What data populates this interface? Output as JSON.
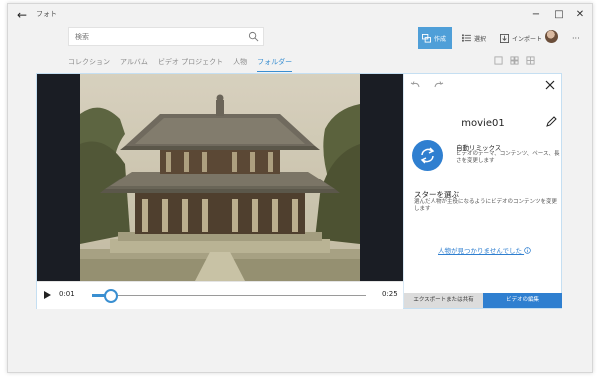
{
  "titlebar": {
    "back": "←",
    "app_title": "フォト",
    "minimize": "−",
    "maximize": "□",
    "close": "✕"
  },
  "toolbar": {
    "search_placeholder": "検索",
    "create_label": "作成",
    "select_label": "選択",
    "import_label": "インポート",
    "more": "···"
  },
  "nav": {
    "items": [
      {
        "label": "コレクション"
      },
      {
        "label": "アルバム"
      },
      {
        "label": "ビデオ プロジェクト"
      },
      {
        "label": "人物"
      },
      {
        "label": "フォルダー"
      }
    ],
    "active_index": 4
  },
  "player": {
    "current_time": "0:01",
    "end_time": "0:25",
    "progress": 0.07
  },
  "panel": {
    "movie_title": "movie01",
    "remix_title": "自動リミックス",
    "remix_desc": "ビデオのテーマ、コンテンツ、ペース、長さを変更します",
    "star_title": "スターを選ぶ",
    "star_desc": "選んだ人物が主役になるようにビデオのコンテンツを変更します",
    "people_link": "人物が見つかりませんでした",
    "export_label": "エクスポートまたは共有",
    "edit_label": "ビデオの編集"
  },
  "colors": {
    "accent": "#2f7fd0",
    "nav_active": "#3a8fd1"
  }
}
